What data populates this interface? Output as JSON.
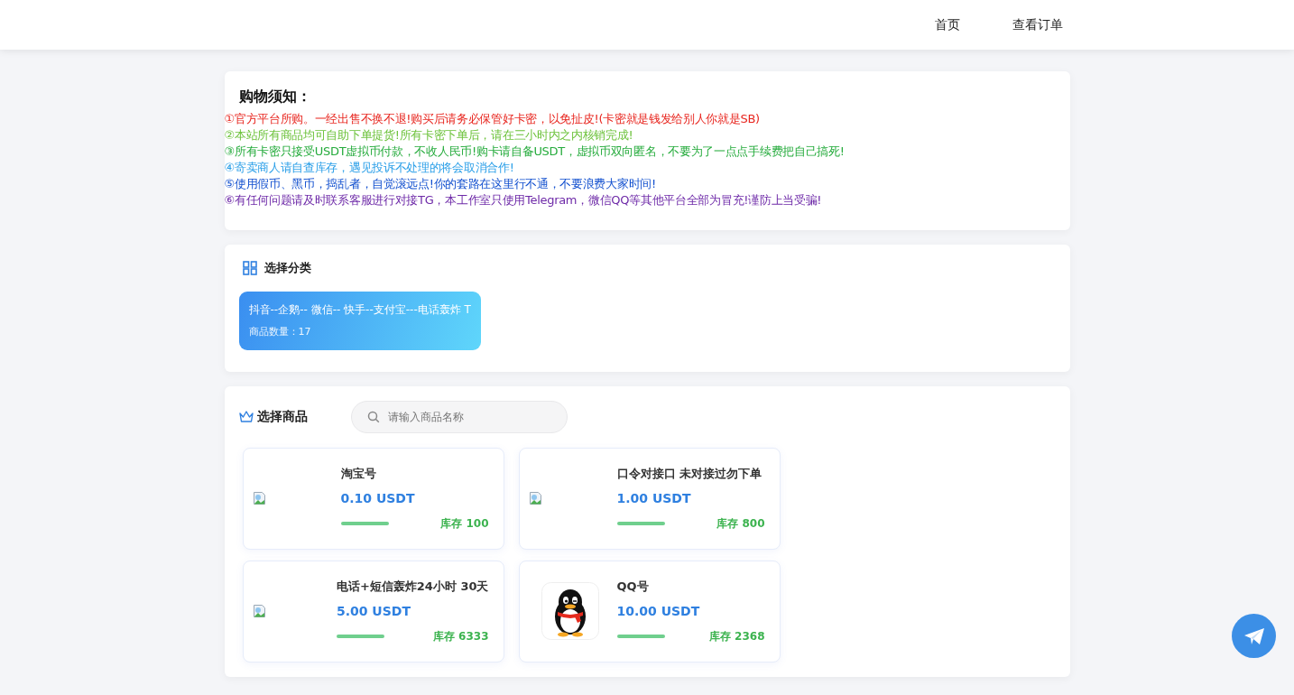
{
  "nav": {
    "items": [
      {
        "label": "首页"
      },
      {
        "label": "查看订单"
      }
    ]
  },
  "notice": {
    "title": "购物须知：",
    "lines": [
      {
        "text": "①官方平台所购。一经出售不换不退!购买后请务必保管好卡密，以免扯皮!(卡密就是钱发给别人你就是SB)",
        "color": "#e8261f"
      },
      {
        "text": "②本站所有商品均可自助下单提货!所有卡密下单后，请在三小时内之内核销完成!",
        "color": "#6cc23a"
      },
      {
        "text": "③所有卡密只接受USDT虚拟币付款，不收人民币!购卡请自备USDT，虚拟币双向匿名，不要为了一点点手续费把自己搞死!",
        "color": "#25ab3c"
      },
      {
        "text": "④寄卖商人请自查库存，遇见投诉不处理的将会取消合作!",
        "color": "#2a9fe8"
      },
      {
        "text": "⑤使用假币、黑币，捣乱者，自觉滚远点!你的套路在这里行不通，不要浪费大家时间!",
        "color": "#1250cf"
      },
      {
        "text": "⑥有任何问题请及时联系客服进行对接TG，本工作室只使用Telegram，微信QQ等其他平台全部为冒充!谨防上当受骗!",
        "color": "#6e2aa8"
      }
    ]
  },
  "categories": {
    "title": "选择分类",
    "items": [
      {
        "name": "抖音--企鹅-- 微信-- 快手--支付宝---电话轰炸 T",
        "count_label": "商品数量：17",
        "selected": true
      }
    ]
  },
  "products": {
    "title": "选择商品",
    "search": {
      "placeholder": "请输入商品名称"
    },
    "items": [
      {
        "kind": "broken",
        "name": "淘宝号",
        "price": "0.10 USDT",
        "stock": "库存 100"
      },
      {
        "kind": "broken",
        "name": "口令对接口 未对接过勿下单",
        "price": "1.00 USDT",
        "stock": "库存 800"
      },
      {
        "kind": "broken",
        "name": "电话+短信轰炸24小时 30天",
        "price": "5.00 USDT",
        "stock": "库存 6333"
      },
      {
        "kind": "penguin",
        "name": "QQ号",
        "price": "10.00 USDT",
        "stock": "库存 2368"
      }
    ]
  }
}
